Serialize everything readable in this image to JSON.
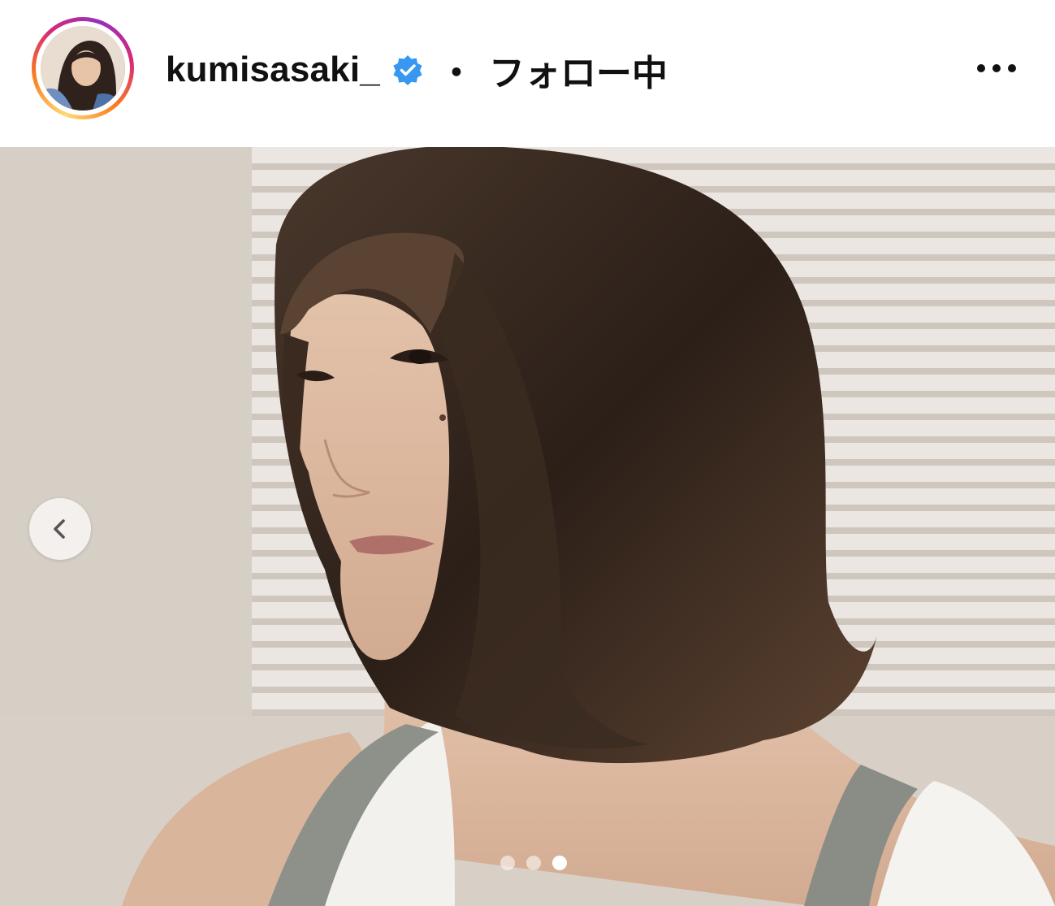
{
  "header": {
    "username": "kumisasaki_",
    "verified": true,
    "separator": "・",
    "follow_status": "フォロー中",
    "avatar_icon": "profile-avatar",
    "more_icon": "more-options-icon"
  },
  "carousel": {
    "prev_icon": "chevron-left-icon",
    "slide_count": 3,
    "active_slide": 3
  },
  "colors": {
    "verified_badge": "#3897f0",
    "text": "#111111"
  }
}
